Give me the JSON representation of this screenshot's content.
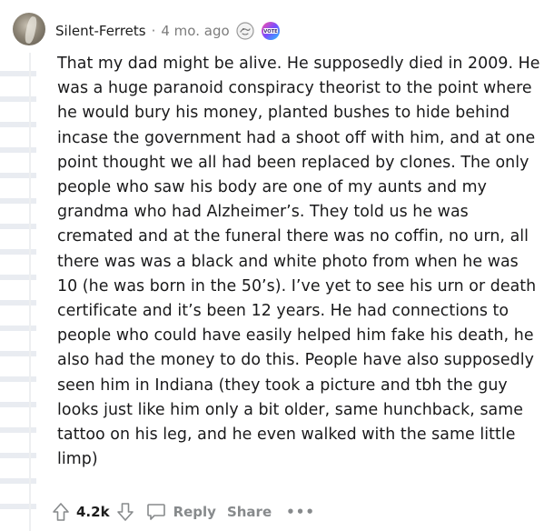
{
  "comment": {
    "username": "Silent-Ferrets",
    "separator": "·",
    "time": "4 mo. ago",
    "body": "That my dad might be alive. He supposedly died in 2009. He was a huge paranoid conspiracy theorist to the point where he would bury his money, planted bushes to hide behind incase the government had a shoot off with him, and at one point thought we all had been replaced by clones. The only people who saw his body are one of my aunts and my grandma who had Alzheimer’s. They told us he was cremated and at the funeral there was no coffin, no urn, all there was was a black and white photo from when he was 10 (he was born in the 50’s). I’ve yet to see his urn or death certificate and it’s been 12 years. He had connections to people who could have easily helped him fake his death, he also had the money to do this. People have also supposedly seen him in Indiana (they took a picture and tbh the guy looks just like him only a bit older, same hunchback, same tattoo on his leg, and he even walked with the same little limp)"
  },
  "awards": [
    {
      "icon": "helpful-award-icon"
    },
    {
      "icon": "vote-award-icon",
      "text": "VOTE"
    }
  ],
  "actions": {
    "score": "4.2k",
    "reply_label": "Reply",
    "share_label": "Share",
    "more_label": "•••"
  },
  "colors": {
    "text": "#1a1a1b",
    "meta": "#7c7c7c",
    "action": "#878a8c"
  }
}
